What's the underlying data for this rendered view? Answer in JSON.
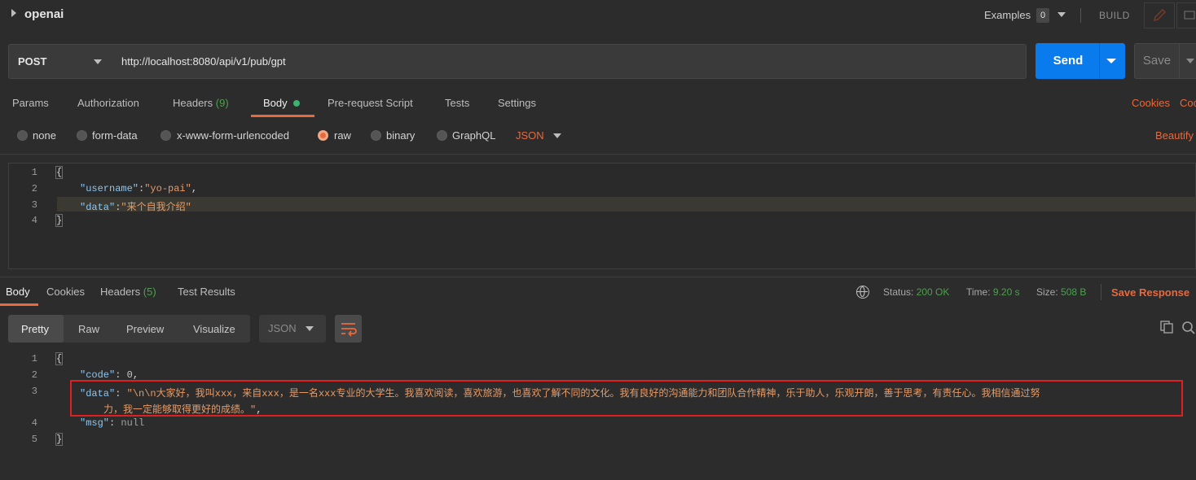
{
  "top": {
    "collection": "openai",
    "examples_label": "Examples",
    "examples_count": "0",
    "build_label": "BUILD"
  },
  "request": {
    "method": "POST",
    "url": "http://localhost:8080/api/v1/pub/gpt",
    "send_label": "Send",
    "save_label": "Save"
  },
  "request_tabs": {
    "params": "Params",
    "authorization": "Authorization",
    "headers": "Headers",
    "headers_count": "(9)",
    "body": "Body",
    "prerequest": "Pre-request Script",
    "tests": "Tests",
    "settings": "Settings",
    "cookies": "Cookies",
    "code": "Coc"
  },
  "body_types": {
    "none": "none",
    "form_data": "form-data",
    "urlencoded": "x-www-form-urlencoded",
    "raw": "raw",
    "binary": "binary",
    "graphql": "GraphQL",
    "format": "JSON",
    "beautify": "Beautify",
    "selected": "raw"
  },
  "request_body": {
    "line_numbers": [
      "1",
      "2",
      "3",
      "4"
    ],
    "open": "{",
    "username_key": "\"username\"",
    "username_value": "\"yo-pai\"",
    "data_key": "\"data\"",
    "data_value": "\"来个自我介绍\"",
    "close": "}"
  },
  "response_tabs": {
    "body": "Body",
    "cookies": "Cookies",
    "headers": "Headers",
    "headers_count": "(5)",
    "test_results": "Test Results"
  },
  "response_meta": {
    "status_label": "Status:",
    "status_value": "200 OK",
    "time_label": "Time:",
    "time_value": "9.20 s",
    "size_label": "Size:",
    "size_value": "508 B",
    "save_response": "Save Response"
  },
  "response_view": {
    "pretty": "Pretty",
    "raw": "Raw",
    "preview": "Preview",
    "visualize": "Visualize",
    "format": "JSON"
  },
  "response_body": {
    "line_numbers": [
      "1",
      "2",
      "3",
      "4",
      "5"
    ],
    "open": "{",
    "code_key": "\"code\"",
    "code_value": "0",
    "data_key": "\"data\"",
    "data_value_line1": "\"\\n\\n大家好，我叫xxx，来自xxx，是一名xxx专业的大学生。我喜欢阅读，喜欢旅游，也喜欢了解不同的文化。我有良好的沟通能力和团队合作精神，乐于助人，乐观开朗，善于思考，有责任心。我相信通过努",
    "data_value_line2": "力，我一定能够取得更好的成绩。\"",
    "msg_key": "\"msg\"",
    "msg_value": "null",
    "close": "}"
  },
  "colors": {
    "accent_orange": "#e8693c",
    "send_blue": "#097bed",
    "status_green": "#4ca14c",
    "highlight_red": "#e02020"
  }
}
